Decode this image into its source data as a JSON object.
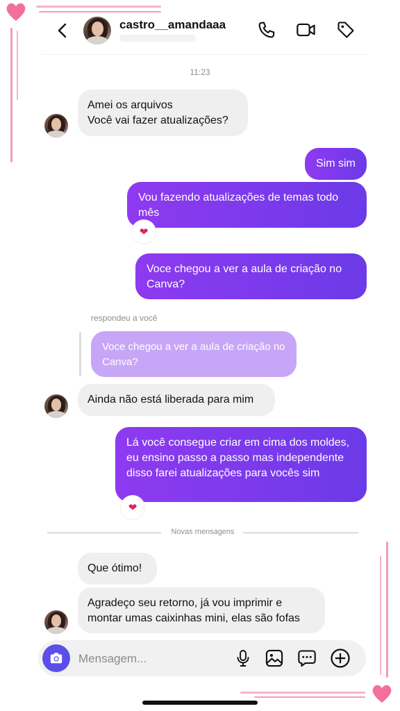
{
  "header": {
    "username": "castro__amandaaa",
    "back_icon": "chevron-left-icon",
    "call_icon": "phone-icon",
    "video_icon": "video-camera-icon",
    "tag_icon": "tag-icon"
  },
  "timestamp": "11:23",
  "messages": {
    "m1_line1": "Amei os arquivos",
    "m1_line2": "Você vai fazer atualizações?",
    "m2": "Sim sim",
    "m3": "Vou fazendo atualizações de temas todo mês",
    "m4": "Voce chegou a ver a aula de criação no Canva?",
    "reply_label": "respondeu a você",
    "reply_quote": "Voce chegou a ver a aula de criação no Canva?",
    "m5": "Ainda não está liberada para mim",
    "m6": "Lá você consegue criar em cima dos moldes, eu ensino passo a passo mas independente disso farei atualizações para vocês sim",
    "new_messages_label": "Novas mensagens",
    "m7": "Que ótimo!",
    "m8": "Agradeço seu retorno, já vou imprimir e montar umas caixinhas mini, elas são fofas"
  },
  "reactions": {
    "heart": "❤"
  },
  "composer": {
    "placeholder": "Mensagem...",
    "camera_icon": "camera-icon",
    "mic_icon": "microphone-icon",
    "gallery_icon": "image-icon",
    "sticker_icon": "chat-bubble-icon",
    "add_icon": "plus-circle-icon"
  },
  "colors": {
    "outgoing_start": "#8e3af0",
    "outgoing_end": "#6c3ae8",
    "incoming": "#efefef",
    "reply_quote": "#c7a6f7",
    "camera_button": "#5b4fe9",
    "frame_pink": "#f49bbf",
    "heart_pink": "#f2709c"
  }
}
